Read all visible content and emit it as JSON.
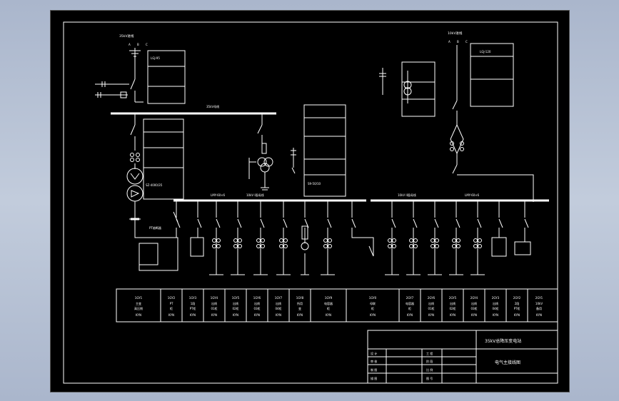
{
  "feeders": [
    {
      "code": "1GY1",
      "line1": "主变",
      "line2": "高压侧"
    },
    {
      "code": "1GY2",
      "line1": "PT",
      "line2": "柜"
    },
    {
      "code": "1GY3",
      "line1": "1段",
      "line2": "PT柜"
    },
    {
      "code": "1GY4",
      "line1": "出线",
      "line2": "01柜"
    },
    {
      "code": "1GY5",
      "line1": "出线",
      "line2": "02柜"
    },
    {
      "code": "1GY6",
      "line1": "出线",
      "line2": "03柜"
    },
    {
      "code": "1GY7",
      "line1": "出线",
      "line2": "04柜"
    },
    {
      "code": "1GY8",
      "line1": "所用",
      "line2": "变"
    },
    {
      "code": "1GY9",
      "line1": "电容器",
      "line2": "柜"
    },
    {
      "code": "1GY0",
      "line1": "母联",
      "line2": "柜"
    },
    {
      "code": "2GY7",
      "line1": "电容器",
      "line2": "柜"
    },
    {
      "code": "2GY6",
      "line1": "出线",
      "line2": "01柜"
    },
    {
      "code": "2GY5",
      "line1": "出线",
      "line2": "02柜"
    },
    {
      "code": "2GY4",
      "line1": "出线",
      "line2": "03柜"
    },
    {
      "code": "2GY3",
      "line1": "出线",
      "line2": "04柜"
    },
    {
      "code": "2GY2",
      "line1": "2段",
      "line2": "PT柜"
    },
    {
      "code": "2GY1",
      "line1": "10kV",
      "line2": "备用"
    }
  ],
  "cabinet_type": "KYN",
  "titleblock": {
    "project": "35kV总降压变电站",
    "drawing": "电气主接线图",
    "rows_left": [
      "设 计",
      "审 核",
      "制 图",
      "描 图"
    ],
    "rows_mid": [
      "工 程",
      "阶 段",
      "比 例",
      "图 号"
    ]
  },
  "labels": {
    "hv_incoming": "35kV进线",
    "phases": [
      "A",
      "B",
      "C"
    ],
    "bus35": "35kV母线",
    "bus10_1": "10kV I段母线",
    "bus10_2": "10kV II段母线",
    "lgj": "LGJ-95",
    "tr_note": "SZ-4000/35",
    "station_tr": "S9-50/10",
    "cable_left": "LMY-60×6",
    "cable_right": "LMY-60×6",
    "ptfuse": "PT熔断器",
    "lgj2": "LGJ-120",
    "right_in": "10kV进线"
  },
  "colors": {
    "background": "#000000",
    "line": "#ffffff",
    "frame": "#b9c3d6"
  }
}
